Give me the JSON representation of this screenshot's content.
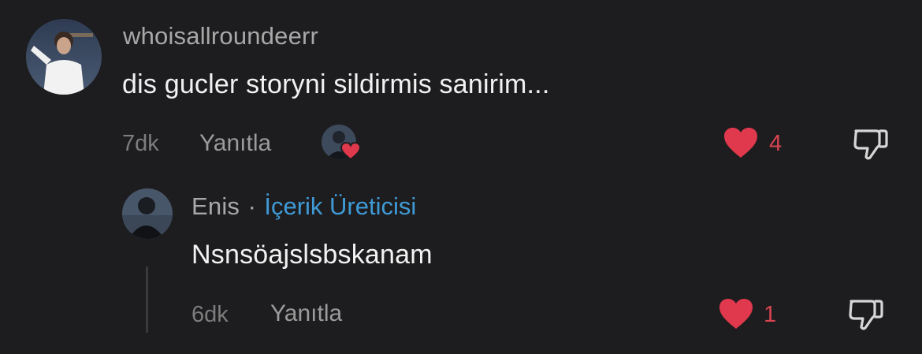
{
  "comments": [
    {
      "username": "whoisallroundeerr",
      "text": "dis gucler storyni sildirmis sanirim...",
      "time": "7dk",
      "reply_label": "Yanıtla",
      "likes": "4"
    }
  ],
  "reply": {
    "username": "Enis",
    "separator": "·",
    "badge": "İçerik Üreticisi",
    "text": "Nsnsöajslsbskanam",
    "time": "6dk",
    "reply_label": "Yanıtla",
    "likes": "1"
  },
  "colors": {
    "background": "#1d1d1f",
    "like": "#e0384c",
    "creator_badge": "#3f9ad6"
  },
  "icons": [
    "heart-icon",
    "dislike-icon",
    "creator-liked-heart-icon"
  ]
}
